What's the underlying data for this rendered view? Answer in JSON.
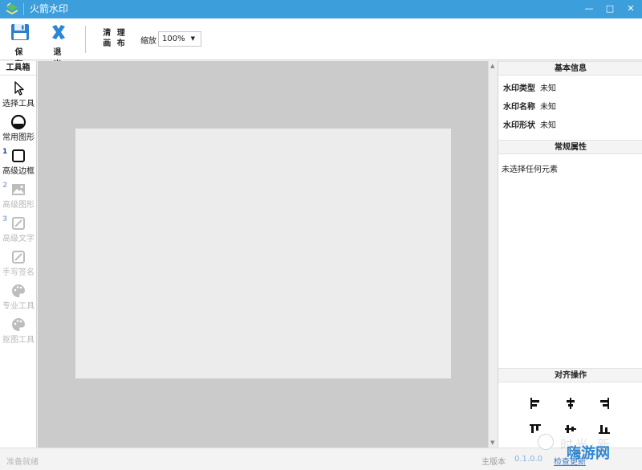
{
  "window": {
    "title": "火箭水印",
    "controls": {
      "minimize": "—",
      "maximize": "□",
      "close": "✕"
    }
  },
  "toolbar": {
    "save_label": "保 存",
    "exit_label": "退 出",
    "clear_label_line1": "清 理",
    "clear_label_line2": "画 布",
    "zoom_label": "缩放",
    "zoom_value": "100%"
  },
  "toolbox": {
    "title": "工具箱",
    "items": [
      {
        "label": "选择工具",
        "icon": "pointer-icon",
        "enabled": true,
        "step": ""
      },
      {
        "label": "常用图形",
        "icon": "circle-shape-icon",
        "enabled": true,
        "step": ""
      },
      {
        "label": "高级边框",
        "icon": "square-frame-icon",
        "enabled": true,
        "step": "1"
      },
      {
        "label": "高级图形",
        "icon": "image-icon",
        "enabled": false,
        "step": "2"
      },
      {
        "label": "高级文字",
        "icon": "edit-icon",
        "enabled": false,
        "step": "3"
      },
      {
        "label": "手写签名",
        "icon": "edit-icon",
        "enabled": false,
        "step": ""
      },
      {
        "label": "专业工具",
        "icon": "palette-icon",
        "enabled": false,
        "step": ""
      },
      {
        "label": "抠图工具",
        "icon": "palette-icon",
        "enabled": false,
        "step": ""
      }
    ]
  },
  "properties": {
    "basic_title": "基本信息",
    "rows": [
      {
        "key": "水印类型",
        "value": "未知"
      },
      {
        "key": "水印名称",
        "value": "未知"
      },
      {
        "key": "水印形状",
        "value": "未知"
      }
    ],
    "general_title": "常规属性",
    "no_selection": "未选择任何元素",
    "align_title": "对齐操作"
  },
  "statusbar": {
    "status": "准备就绪",
    "version_label": "主版本",
    "version_value": "0.1.0.0",
    "check_update": "检查更新"
  },
  "overlay": {
    "watermark_ghost": "时光·新",
    "site_logo": "嗨游网"
  },
  "colors": {
    "titlebar": "#3c9edb",
    "accent": "#2f85d0",
    "workspace": "#cbcbcb",
    "canvas": "#ececec"
  }
}
